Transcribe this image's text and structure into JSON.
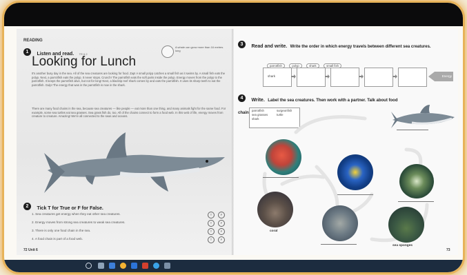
{
  "left_page": {
    "section_label": "READING",
    "activity1": {
      "number": "1",
      "title": "Listen and read.",
      "audio_code": "TR 6.2"
    },
    "title": "Looking for Lunch",
    "fact_bubble": "A whale can grow more than 16 metres long",
    "paragraph1": "It's another busy day in the sea. All of the sea creatures are looking for food. Zap! A small polyp catches a small fish as it swims by. A small fish eats the polyp. Next, a parrotfish eats the polyp. It never stops. Crunch! The parrotfish eats the soft parts inside the polyp. Energy moves from the polyp to the parrotfish. It keeps the parrotfish alive, but not for long! Next, a blacktip reef shark comes by and eats the parrotfish. It uses its sharp teeth to eat the parrotfish. Gulp! The energy that was in the parrotfish is now in the shark.",
    "paragraph2": "There are many food chains in the sea, because sea creatures — like people — eat more than one thing, and many animals fight for the same food. For example, some sea turtles eat sea grasses. Sea grass fish do, too. All of the chains connect to form a food web. In this web of life, energy moves from creature to creature. Amazing! We're all connected to the seas and oceans.",
    "activity2": {
      "number": "2",
      "title": "Tick T for True or F for False."
    },
    "statements": [
      "1. Sea creatures get energy when they eat other sea creatures.",
      "2. Energy moves from strong sea creatures to weak sea creatures.",
      "3. There is only one food chain in the sea.",
      "4. A food chain is part of a food web."
    ],
    "true_mark": "T",
    "false_mark": "F",
    "footer": "72  Unit 6"
  },
  "right_page": {
    "activity3": {
      "number": "3",
      "title": "Read and write.",
      "instruction": "Write the order in which energy travels between different sea creatures.",
      "word_bank": [
        "parrotfish",
        "polyp",
        "shark",
        "small fish"
      ],
      "chain_boxes": [
        "shark",
        "",
        "",
        "",
        ""
      ],
      "end_label": "Energy"
    },
    "activity4": {
      "number": "4",
      "title": "Write.",
      "instruction": "Label the sea creatures. Then work with a partner. Talk about food chains and the food web.",
      "word_bank": [
        "parrotfish",
        "surgeonfish",
        "sea grasses",
        "turtle",
        "shark"
      ],
      "photo_labels": {
        "coral": "coral",
        "sponges": "sea sponges"
      }
    },
    "footer": "73"
  },
  "colors": {
    "frame_glow": "#e9a94c",
    "taskbar": "#1c2c3f",
    "shark": "#7d8b96"
  }
}
